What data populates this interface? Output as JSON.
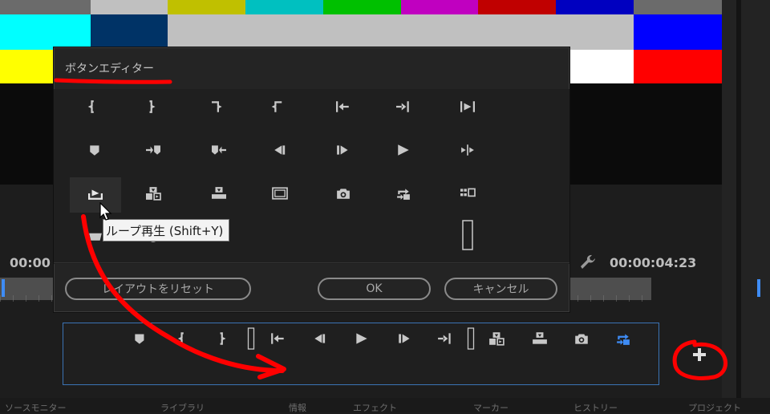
{
  "colors": {
    "bars_top": [
      "#6b6b6b",
      "#c0c0c0",
      "#c0c000",
      "#00c0c0",
      "#00c000",
      "#c000c0",
      "#c00000",
      "#0000c0",
      "#6b6b6b"
    ],
    "bars_mid": [
      "#00ffff",
      "#003366",
      "#c0c0c0",
      "#c0c0c0",
      "#c0c0c0",
      "#c0c0c0",
      "#c0c0c0",
      "#c0c0c0",
      "#0000ff"
    ],
    "bars_bot": [
      "#ffff00",
      "#1e1e1e",
      "#1e1e1e",
      "#1e1e1e",
      "#1e1e1e",
      "#1e1e1e",
      "#1e1e1e",
      "#ffffff",
      "#ff0000"
    ],
    "accent": "#3e8cf5",
    "annotation_red": "#ff0000"
  },
  "timecodes": {
    "left": "00:00",
    "right": "00:00:04:23"
  },
  "dialog": {
    "title": "ボタンエディター",
    "grid": [
      [
        "mark-in-icon",
        "mark-out-icon",
        "mark-clip-icon",
        "go-in-out-icon",
        "go-to-in-icon",
        "go-to-out-icon",
        "play-in-to-out-icon"
      ],
      [
        "add-marker-icon",
        "next-marker-icon",
        "prev-marker-icon",
        "step-back-icon",
        "step-forward-icon",
        "play-icon",
        "shuttle-icon"
      ],
      [
        "export-frame-icon",
        "insert-icon",
        "overwrite-icon",
        "safe-margins-icon",
        "camera-icon",
        "loop-icon",
        "multi-camera-icon"
      ],
      [
        "vr-icon",
        "proxy-icon",
        "",
        "",
        "",
        "",
        "spacer-icon"
      ]
    ],
    "reset_button": "レイアウトをリセット",
    "ok_button": "OK",
    "cancel_button": "キャンセル"
  },
  "tooltip": "ループ再生 (Shift+Y)",
  "transport": {
    "icons": [
      "add-marker-icon",
      "mark-in-icon",
      "mark-out-icon",
      "spacer-icon",
      "go-to-in-icon",
      "step-back-icon",
      "play-icon",
      "step-forward-icon",
      "go-to-out-icon",
      "spacer-icon",
      "insert-icon",
      "overwrite-icon",
      "camera-icon",
      "loop-icon"
    ]
  },
  "add_button_icon": "plus-icon",
  "bottom_tabs": [
    "ソースモニター",
    "ライブラリ",
    "情報",
    "エフェクト",
    "マーカー",
    "ヒストリー",
    "プロジェクト"
  ]
}
